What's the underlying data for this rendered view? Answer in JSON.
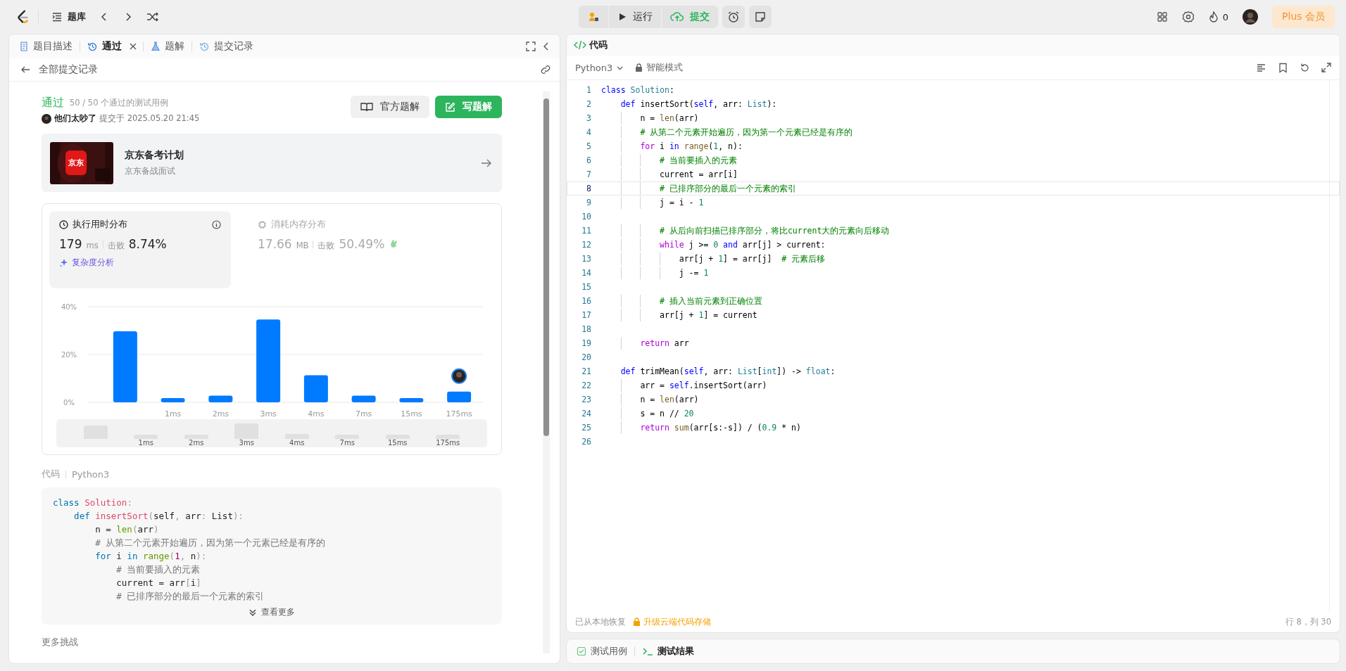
{
  "topbar": {
    "problem_list": "题库",
    "run": "运行",
    "submit": "提交",
    "streak": "0",
    "plus": "Plus 会员"
  },
  "left_tabs": [
    {
      "label": "题目描述",
      "selected": false,
      "kind": "doc",
      "closable": false
    },
    {
      "label": "通过",
      "selected": true,
      "kind": "history",
      "closable": true
    },
    {
      "label": "题解",
      "selected": false,
      "kind": "flask",
      "closable": false
    },
    {
      "label": "提交记录",
      "selected": false,
      "kind": "history",
      "closable": false
    }
  ],
  "back_link": "全部提交记录",
  "result": {
    "status": "通过",
    "cases": "50 / 50 个通过的测试用例",
    "user": "他们太吵了",
    "submitted": "提交于 2025.05.20 21:45",
    "official_button": "官方题解",
    "write_button": "写题解"
  },
  "promo": {
    "logo": "京东",
    "title": "京东备考计划",
    "subtitle": "京东备战面试"
  },
  "stats": [
    {
      "kind": "time",
      "title": "执行用时分布",
      "value": "179",
      "unit": "ms",
      "beat_label": "击败",
      "beat": "8.74%",
      "analysis": "复杂度分析",
      "selected": true
    },
    {
      "kind": "memory",
      "title": "消耗内存分布",
      "value": "17.66",
      "unit": "MB",
      "beat_label": "击败",
      "beat": "50.49%",
      "selected": false
    }
  ],
  "chart_data": {
    "type": "bar",
    "categories": [
      null,
      "1ms",
      "2ms",
      "3ms",
      "4ms",
      "7ms",
      "15ms",
      "175ms"
    ],
    "ylim": [
      0,
      40
    ],
    "yticks": [
      {
        "value": 0,
        "label": "0%"
      },
      {
        "value": 20,
        "label": "20%"
      },
      {
        "value": 40,
        "label": "40%"
      }
    ],
    "series": [
      {
        "color": "#007aff",
        "values": [
          29.7,
          1.8,
          2.8,
          34.6,
          11.3,
          2.8,
          1.8,
          4.5
        ]
      }
    ]
  },
  "overview_labels": [
    "1ms",
    "2ms",
    "3ms",
    "4ms",
    "7ms",
    "15ms",
    "175ms"
  ],
  "code_section": {
    "label": "代码",
    "language": "Python3",
    "more": "查看更多",
    "lines": [
      "class Solution:",
      "    def insertSort(self, arr: List):",
      "        n = len(arr)",
      "        # 从第二个元素开始遍历，因为第一个元素已经是有序的",
      "        for i in range(1, n):",
      "            # 当前要插入的元素",
      "            current = arr[i]",
      "            # 已排序部分的最后一个元素的索引"
    ]
  },
  "more_challenges": "更多挑战",
  "editor": {
    "title": "代码",
    "language": "Python3",
    "mode": "智能模式",
    "restored": "已从本地恢复",
    "upgrade": "升级云端代码存储",
    "cursor": "行 8，列 30",
    "lines": [
      {
        "n": "1",
        "text": "class Solution:",
        "selected": false
      },
      {
        "n": "2",
        "text": "    def insertSort(self, arr: List):",
        "selected": false
      },
      {
        "n": "3",
        "text": "        n = len(arr)",
        "selected": false
      },
      {
        "n": "4",
        "text": "        # 从第二个元素开始遍历，因为第一个元素已经是有序的",
        "selected": false
      },
      {
        "n": "5",
        "text": "        for i in range(1, n):",
        "selected": false
      },
      {
        "n": "6",
        "text": "            # 当前要插入的元素",
        "selected": false
      },
      {
        "n": "7",
        "text": "            current = arr[i]",
        "selected": false
      },
      {
        "n": "8",
        "text": "            # 已排序部分的最后一个元素的索引",
        "selected": true
      },
      {
        "n": "9",
        "text": "            j = i - 1",
        "selected": false
      },
      {
        "n": "10",
        "selected": false
      },
      {
        "n": "11",
        "text": "            # 从后向前扫描已排序部分，将比current大的元素向后移动",
        "selected": false
      },
      {
        "n": "12",
        "text": "            while j >= 0 and arr[j] > current:",
        "selected": false
      },
      {
        "n": "13",
        "text": "                arr[j + 1] = arr[j]  # 元素后移",
        "selected": false
      },
      {
        "n": "14",
        "text": "                j -= 1",
        "selected": false
      },
      {
        "n": "15",
        "selected": false
      },
      {
        "n": "16",
        "text": "            # 插入当前元素到正确位置",
        "selected": false
      },
      {
        "n": "17",
        "text": "            arr[j + 1] = current",
        "selected": false
      },
      {
        "n": "18",
        "selected": false
      },
      {
        "n": "19",
        "text": "        return arr",
        "selected": false
      },
      {
        "n": "20",
        "selected": false
      },
      {
        "n": "21",
        "text": "    def trimMean(self, arr: List[int]) -> float:",
        "selected": false
      },
      {
        "n": "22",
        "text": "        arr = self.insertSort(arr)",
        "selected": false
      },
      {
        "n": "23",
        "text": "        n = len(arr)",
        "selected": false
      },
      {
        "n": "24",
        "text": "        s = n // 20",
        "selected": false
      },
      {
        "n": "25",
        "text": "        return sum(arr[s:-s]) / (0.9 * n)",
        "selected": false
      },
      {
        "n": "26",
        "selected": false
      }
    ]
  },
  "bottom_tabs": [
    {
      "label": "测试用例",
      "selected": false,
      "kind": "cases"
    },
    {
      "label": "测试结果",
      "selected": true,
      "kind": "result"
    }
  ]
}
